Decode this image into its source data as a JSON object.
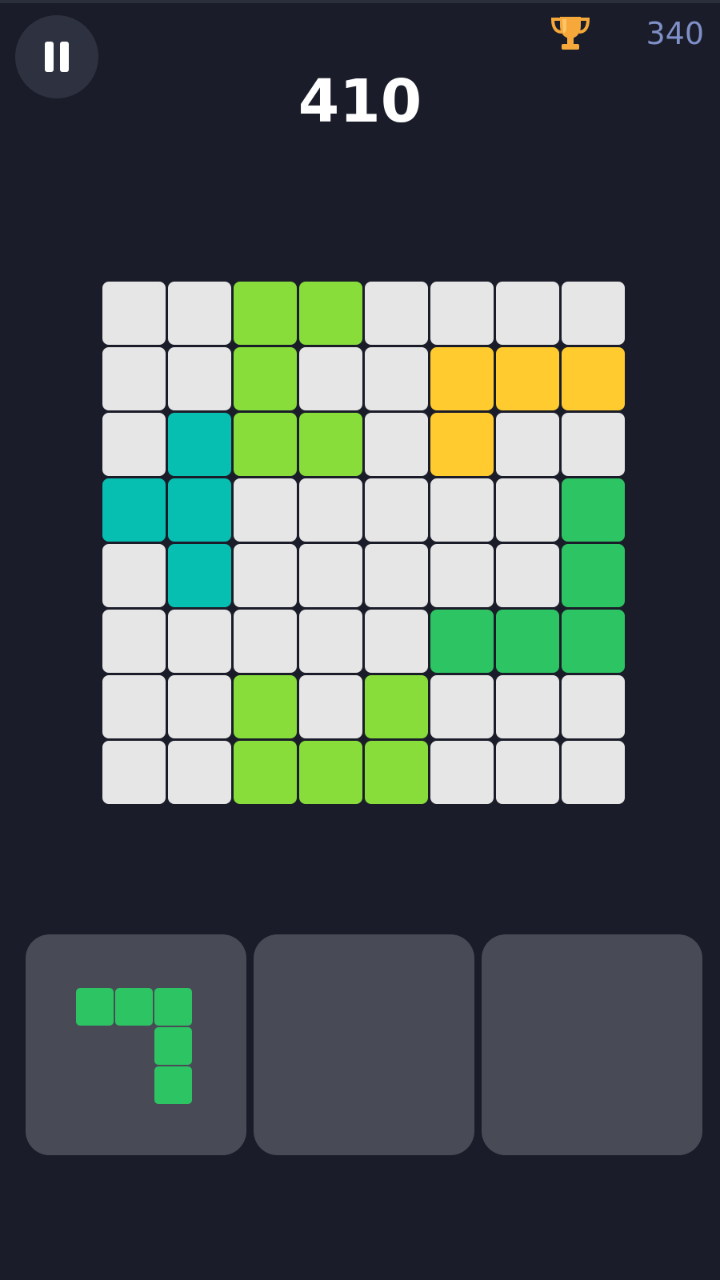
{
  "header": {
    "pause_icon": "pause-icon",
    "trophy_icon": "trophy-icon",
    "best_score": "340",
    "score": "410"
  },
  "colors": {
    "background": "#1a1d29",
    "empty": "#e6e6e6",
    "lime": "#88dd3a",
    "yellow": "#ffcb2e",
    "teal": "#07bfb1",
    "green": "#2dc463",
    "tray": "#484b56",
    "best_score_text": "#7f8fc7"
  },
  "board": {
    "rows": 8,
    "cols": 8,
    "cells": [
      [
        "empty",
        "empty",
        "lime",
        "lime",
        "empty",
        "empty",
        "empty",
        "empty"
      ],
      [
        "empty",
        "empty",
        "lime",
        "empty",
        "empty",
        "yellow",
        "yellow",
        "yellow"
      ],
      [
        "empty",
        "teal",
        "lime",
        "lime",
        "empty",
        "yellow",
        "empty",
        "empty"
      ],
      [
        "teal",
        "teal",
        "empty",
        "empty",
        "empty",
        "empty",
        "empty",
        "green"
      ],
      [
        "empty",
        "teal",
        "empty",
        "empty",
        "empty",
        "empty",
        "empty",
        "green"
      ],
      [
        "empty",
        "empty",
        "empty",
        "empty",
        "empty",
        "green",
        "green",
        "green"
      ],
      [
        "empty",
        "empty",
        "lime",
        "empty",
        "lime",
        "empty",
        "empty",
        "empty"
      ],
      [
        "empty",
        "empty",
        "lime",
        "lime",
        "lime",
        "empty",
        "empty",
        "empty"
      ]
    ]
  },
  "trays": [
    {
      "piece": {
        "color": "green",
        "shape": [
          [
            1,
            1,
            1
          ],
          [
            0,
            0,
            1
          ],
          [
            0,
            0,
            1
          ]
        ]
      }
    },
    {
      "piece": null
    },
    {
      "piece": null
    }
  ]
}
